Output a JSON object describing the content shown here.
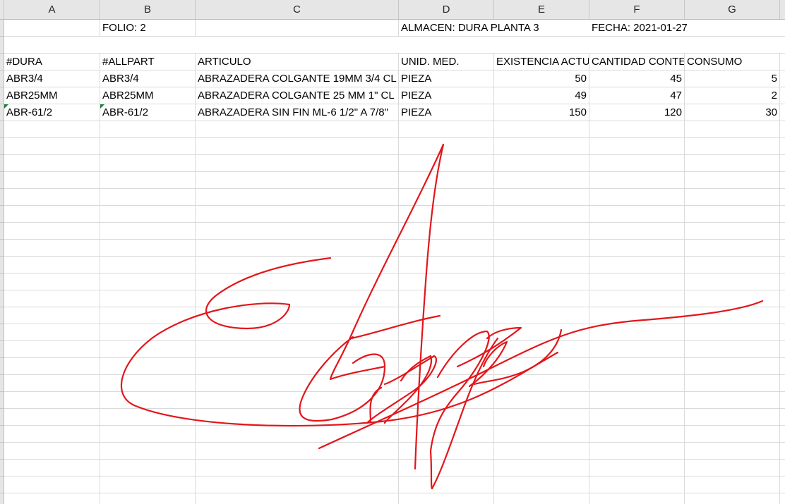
{
  "columns": [
    "A",
    "B",
    "C",
    "D",
    "E",
    "F",
    "G"
  ],
  "header_info": {
    "folio": "FOLIO: 2",
    "almacen": "ALMACEN: DURA PLANTA 3",
    "fecha": "FECHA: 2021-01-27"
  },
  "table_headers": {
    "dura": "#DURA",
    "allpart": "#ALLPART",
    "articulo": "ARTICULO",
    "unid_med": "UNID. MED.",
    "existencia": "EXISTENCIA ACTU",
    "cantidad": "CANTIDAD CONTE",
    "consumo": "CONSUMO"
  },
  "rows": [
    {
      "dura": "ABR3/4",
      "allpart": "ABR3/4",
      "articulo": "ABRAZADERA COLGANTE 19MM 3/4 CL",
      "unid": "PIEZA",
      "existencia": "50",
      "cantidad": "45",
      "consumo": "5"
    },
    {
      "dura": "ABR25MM",
      "allpart": "ABR25MM",
      "articulo": "ABRAZADERA COLGANTE 25 MM 1\" CL",
      "unid": "PIEZA",
      "existencia": "49",
      "cantidad": "47",
      "consumo": "2"
    },
    {
      "dura": "ABR-61/2",
      "allpart": "ABR-61/2",
      "articulo": "ABRAZADERA SIN FIN  ML-6 1/2\" A 7/8\"",
      "unid": "PIEZA",
      "existencia": "150",
      "cantidad": "120",
      "consumo": "30"
    }
  ],
  "colors": {
    "signature": "#e3161b",
    "grid_line": "#dadada",
    "header_bg": "#e6e6e6",
    "error_marker": "#1e7c3a"
  }
}
